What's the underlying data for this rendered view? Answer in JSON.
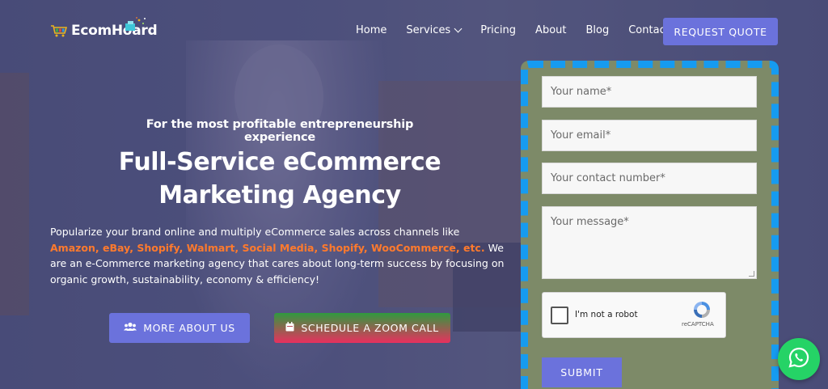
{
  "brand": {
    "name": "EcomHoard",
    "icon": "shopping-cart-icon"
  },
  "nav": {
    "items": [
      {
        "label": "Home"
      },
      {
        "label": "Services",
        "has_dropdown": true
      },
      {
        "label": "Pricing"
      },
      {
        "label": "About"
      },
      {
        "label": "Blog"
      },
      {
        "label": "Contact"
      }
    ],
    "cta_label": "REQUEST QUOTE"
  },
  "hero": {
    "tagline": "For the most profitable entrepreneurship experience",
    "headline_line1": "Full-Service eCommerce",
    "headline_line2": "Marketing Agency",
    "desc_intro": "Popularize your brand online and multiply eCommerce sales across channels like ",
    "desc_channels": "Amazon, eBay, Shopify, Walmart, Social Media, Shopify, WooCommerce, etc.",
    "desc_outro": " We are an e-Commerce marketing agency that cares about long-term success by focusing on organic growth, sustainability, economy & efficiency!",
    "btn_about": {
      "label": "MORE ABOUT US",
      "icon": "users-icon"
    },
    "btn_zoom": {
      "label": "SCHEDULE A ZOOM CALL",
      "icon": "calendar-icon"
    }
  },
  "form": {
    "name_placeholder": "Your name*",
    "email_placeholder": "Your email*",
    "phone_placeholder": "Your contact number*",
    "message_placeholder": "Your message*",
    "captcha_label": "I'm not a robot",
    "captcha_brand": "reCAPTCHA",
    "submit_label": "SUBMIT"
  },
  "whatsapp": {
    "icon": "whatsapp-icon"
  },
  "colors": {
    "accent": "#6b72dc",
    "highlight": "#ff7a2d",
    "form_border": "#169bf0",
    "form_bg": "#7d8a68",
    "whatsapp": "#25d366"
  }
}
